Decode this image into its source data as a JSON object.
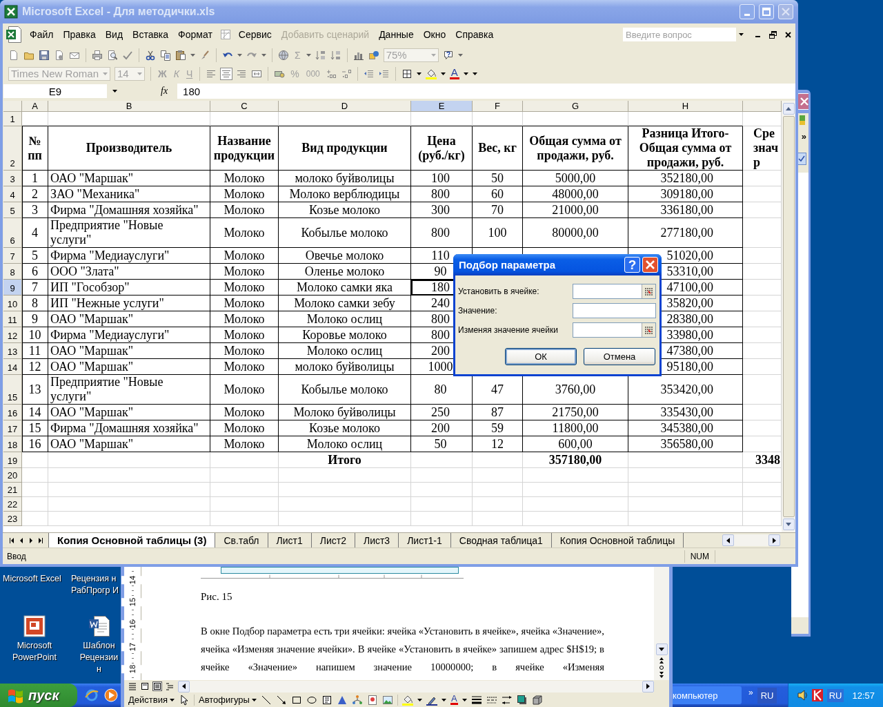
{
  "excel": {
    "title": "Microsoft Excel - Для методички.xls",
    "menu": [
      {
        "kind": "text",
        "label": "Файл",
        "disabled": false
      },
      {
        "kind": "text",
        "label": "Правка",
        "disabled": false
      },
      {
        "kind": "text",
        "label": "Вид",
        "disabled": false
      },
      {
        "kind": "text",
        "label": "Вставка",
        "disabled": false
      },
      {
        "kind": "text",
        "label": "Формат",
        "disabled": false
      },
      {
        "kind": "icon"
      },
      {
        "kind": "text",
        "label": "Сервис",
        "disabled": false
      },
      {
        "kind": "text",
        "label": "Добавить сценарий",
        "disabled": true
      },
      {
        "kind": "text",
        "label": "Данные",
        "disabled": false
      },
      {
        "kind": "text",
        "label": "Окно",
        "disabled": false
      },
      {
        "kind": "text",
        "label": "Справка",
        "disabled": false
      }
    ],
    "question_box": {
      "placeholder": "Введите вопрос"
    },
    "standard_toolbar": {
      "sum": "Σ",
      "zoom": "75%"
    },
    "formatting_toolbar": {
      "font": "Times New Roman",
      "size": "14",
      "bold": "Ж",
      "italic": "К",
      "underline": "Ч",
      "alignment_buttons": [
        {
          "selected": false
        },
        {
          "selected": true
        },
        {
          "selected": false
        }
      ],
      "percent": "%",
      "thousands": "000",
      "font_color": "A"
    },
    "formula_bar": {
      "name_box": "E9",
      "fx": "fx",
      "value": "180"
    },
    "sheet": {
      "columns": [
        {
          "label": "A",
          "selected": false
        },
        {
          "label": "B",
          "selected": false
        },
        {
          "label": "C",
          "selected": false
        },
        {
          "label": "D",
          "selected": false
        },
        {
          "label": "E",
          "selected": true
        },
        {
          "label": "F",
          "selected": false
        },
        {
          "label": "G",
          "selected": false
        },
        {
          "label": "H",
          "selected": false
        }
      ],
      "rows": [
        {
          "number": "1",
          "selected": false,
          "kind": "blank"
        },
        {
          "number": "2",
          "selected": false,
          "kind": "header",
          "cells": {
            "a": "№ пп",
            "b": "Производитель",
            "c": "Название продукции",
            "d": "Вид продукции",
            "e": "Цена (руб./кг)",
            "f": "Вес, кг",
            "g": "Общая сумма от продажи, руб.",
            "h": "Разница Итого-Общая сумма от продажи, руб.",
            "i": "Сре\nзнач\nр"
          }
        },
        {
          "number": "3",
          "selected": false,
          "kind": "data",
          "cells": {
            "a": "1",
            "b": "ОАО \"Маршак\"",
            "c": "Молоко",
            "d": "молоко буйволицы",
            "e": "100",
            "f": "50",
            "g": "5000,00",
            "h": "352180,00"
          }
        },
        {
          "number": "4",
          "selected": false,
          "kind": "data",
          "cells": {
            "a": "2",
            "b": "ЗАО \"Механика\"",
            "c": "Молоко",
            "d": "Молоко верблюдицы",
            "e": "800",
            "f": "60",
            "g": "48000,00",
            "h": "309180,00"
          }
        },
        {
          "number": "5",
          "selected": false,
          "kind": "data",
          "cells": {
            "a": "3",
            "b": "Фирма \"Домашняя хозяйка\"",
            "c": "Молоко",
            "d": "Козье молоко",
            "e": "300",
            "f": "70",
            "g": "21000,00",
            "h": "336180,00"
          }
        },
        {
          "number": "6",
          "selected": false,
          "kind": "data",
          "cells": {
            "a": "4",
            "b": "Предприятие \"Новые услуги\"",
            "c": "Молоко",
            "d": "Кобылье молоко",
            "e": "800",
            "f": "100",
            "g": "80000,00",
            "h": "277180,00"
          }
        },
        {
          "number": "7",
          "selected": false,
          "kind": "data",
          "cells": {
            "a": "5",
            "b": "Фирма \"Медиауслуги\"",
            "c": "Молоко",
            "d": "Овечье молоко",
            "e": "110",
            "h": "51020,00"
          }
        },
        {
          "number": "8",
          "selected": false,
          "kind": "data",
          "cells": {
            "a": "6",
            "b": "ООО \"Злата\"",
            "c": "Молоко",
            "d": "Оленье молоко",
            "e": "90",
            "h": "53310,00"
          }
        },
        {
          "number": "9",
          "selected": true,
          "kind": "data",
          "cells": {
            "a": "7",
            "b": "ИП \"Гособзор\"",
            "c": "Молоко",
            "d": "Молоко самки яка",
            "e": "180",
            "h": "47100,00"
          }
        },
        {
          "number": "10",
          "selected": false,
          "kind": "data",
          "cells": {
            "a": "8",
            "b": "ИП \"Нежные услуги\"",
            "c": "Молоко",
            "d": "Молоко самки зебу",
            "e": "240",
            "h": "35820,00"
          }
        },
        {
          "number": "11",
          "selected": false,
          "kind": "data",
          "cells": {
            "a": "9",
            "b": "ОАО \"Маршак\"",
            "c": "Молоко",
            "d": "Молоко ослиц",
            "e": "800",
            "h": "28380,00"
          }
        },
        {
          "number": "12",
          "selected": false,
          "kind": "data",
          "cells": {
            "a": "10",
            "b": "Фирма \"Медиауслуги\"",
            "c": "Молоко",
            "d": "Коровье молоко",
            "e": "800",
            "h": "33980,00"
          }
        },
        {
          "number": "13",
          "selected": false,
          "kind": "data",
          "cells": {
            "a": "11",
            "b": "ОАО \"Маршак\"",
            "c": "Молоко",
            "d": "Молоко ослиц",
            "e": "200",
            "h": "47380,00"
          }
        },
        {
          "number": "14",
          "selected": false,
          "kind": "data",
          "cells": {
            "a": "12",
            "b": "ОАО \"Маршак\"",
            "c": "Молоко",
            "d": "молоко буйволицы",
            "e": "1000",
            "h": "95180,00"
          }
        },
        {
          "number": "15",
          "selected": false,
          "kind": "data",
          "cells": {
            "a": "13",
            "b": "Предприятие \"Новые услуги\"",
            "c": "Молоко",
            "d": "Кобылье молоко",
            "e": "80",
            "f": "47",
            "g": "3760,00",
            "h": "353420,00"
          }
        },
        {
          "number": "16",
          "selected": false,
          "kind": "data",
          "cells": {
            "a": "14",
            "b": "ОАО \"Маршак\"",
            "c": "Молоко",
            "d": "Молоко буйволицы",
            "e": "250",
            "f": "87",
            "g": "21750,00",
            "h": "335430,00"
          }
        },
        {
          "number": "17",
          "selected": false,
          "kind": "data",
          "cells": {
            "a": "15",
            "b": "Фирма \"Домашняя хозяйка\"",
            "c": "Молоко",
            "d": "Козье молоко",
            "e": "200",
            "f": "59",
            "g": "11800,00",
            "h": "345380,00"
          }
        },
        {
          "number": "18",
          "selected": false,
          "kind": "data",
          "cells": {
            "a": "16",
            "b": "ОАО \"Маршак\"",
            "c": "Молоко",
            "d": "Молоко ослиц",
            "e": "50",
            "f": "12",
            "g": "600,00",
            "h": "356580,00"
          }
        },
        {
          "number": "19",
          "selected": false,
          "kind": "total",
          "cells": {
            "d": "Итого",
            "g": "357180,00",
            "i": "3348"
          }
        },
        {
          "number": "20",
          "selected": false,
          "kind": "blank"
        },
        {
          "number": "21",
          "selected": false,
          "kind": "blank"
        },
        {
          "number": "22",
          "selected": false,
          "kind": "blank"
        },
        {
          "number": "23",
          "selected": false,
          "kind": "blank"
        }
      ]
    },
    "sheet_tabs": [
      {
        "label": "Копия Основной таблицы (3)",
        "selected": true
      },
      {
        "label": "Св.табл",
        "selected": false
      },
      {
        "label": "Лист1",
        "selected": false
      },
      {
        "label": "Лист2",
        "selected": false
      },
      {
        "label": "Лист3",
        "selected": false
      },
      {
        "label": "Лист1-1",
        "selected": false
      },
      {
        "label": "Сводная таблица1",
        "selected": false
      },
      {
        "label": "Копия Основной таблицы",
        "selected": false
      }
    ],
    "status_bar": {
      "mode": "Ввод",
      "num_lock": "NUM"
    }
  },
  "dialog": {
    "title": "Подбор параметра",
    "help": "?",
    "fields": [
      {
        "label": "Установить в ячейке:",
        "kind": "reference"
      },
      {
        "label": "Значение:",
        "kind": "value"
      },
      {
        "label": "Изменяя значение ячейки",
        "kind": "reference"
      }
    ],
    "buttons": [
      {
        "label": "ОК",
        "default": true
      },
      {
        "label": "Отмена",
        "default": false
      }
    ]
  },
  "word": {
    "ruler": [
      "14",
      "15",
      "16",
      "17",
      "18"
    ],
    "caption": "Рис. 15",
    "paragraph": "В окне Подбор параметра есть три ячейки: ячейка «Установить в ячейке», ячейка «Значение», ячейка «Изменяя значение ячейки». В ячейке «Установить в ячейке» запишем адрес $H$19; в ячейке «Значение» напишем значение 10000000; в ячейке «Изменяя",
    "drawing_toolbar": {
      "actions": "Действия",
      "autoshapes": "Автофигуры",
      "font_color": "A"
    }
  },
  "side_window": {
    "chevron": "»"
  },
  "desktop_icons": [
    {
      "label": "Microsoft Excel",
      "kind": "label"
    },
    {
      "label": "Рецензия н РабПрогр И",
      "kind": "label"
    },
    {
      "label": "Microsoft PowerPoint",
      "kind": "powerpoint"
    },
    {
      "label": "Шаблон Рецензии н",
      "kind": "word"
    }
  ],
  "taskbar": {
    "start": "пуск",
    "task": "компьютер",
    "chevron": "»",
    "language": "RU",
    "tray_language": "RU",
    "clock": "12:57"
  }
}
